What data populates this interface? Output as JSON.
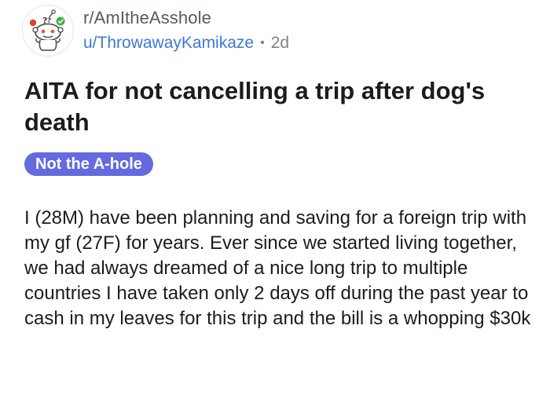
{
  "post": {
    "subreddit": "r/AmItheAsshole",
    "username": "u/ThrowawayKamikaze",
    "separator": "•",
    "age": "2d",
    "title": "AITA for not cancelling a trip after dog's death",
    "flair": "Not the A-hole",
    "body": "I (28M) have been planning and saving for a foreign trip with my gf (27F) for years. Ever since we started living together, we had always dreamed of a nice long trip to multiple countries I have taken only 2 days off during the past year to cash in my leaves for this trip and the bill is a whopping $30k"
  },
  "colors": {
    "flair_bg": "#646be0",
    "username": "#3a7bd5",
    "muted": "#7c8288"
  },
  "icons": {
    "avatar": "subreddit-snoo-icon"
  }
}
